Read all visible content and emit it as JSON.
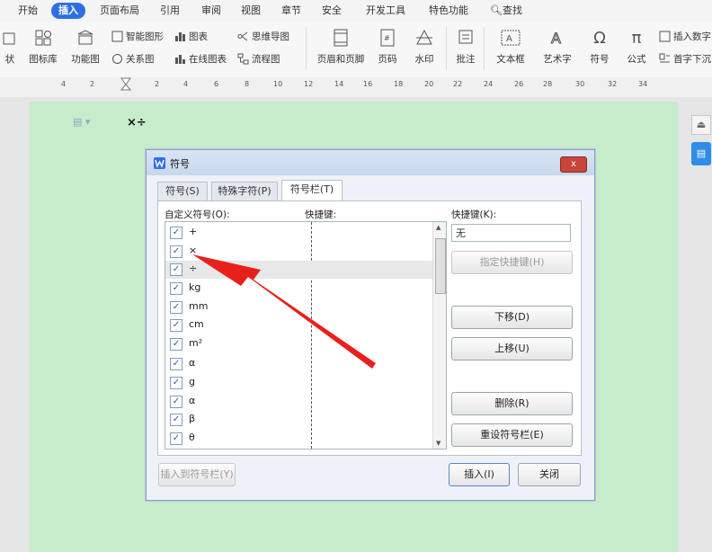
{
  "menu": {
    "tabs": [
      "开始",
      "插入",
      "页面布局",
      "引用",
      "审阅",
      "视图",
      "章节",
      "安全",
      "开发工具",
      "特色功能"
    ],
    "active_tab": "插入",
    "search_label": "查找"
  },
  "ribbon": {
    "shape_partial": "状",
    "icon_library": "图标库",
    "function_chart": "功能图",
    "smart_shape": "智能图形",
    "chart": "图表",
    "mind_map": "思维导图",
    "relation_chart": "关系图",
    "online_chart": "在线图表",
    "flow_chart": "流程图",
    "header_footer": "页眉和页脚",
    "page_number": "页码",
    "watermark": "水印",
    "comment": "批注",
    "text_box": "文本框",
    "art_text": "艺术字",
    "symbol": "符号",
    "formula": "公式",
    "insert_number": "插入数字",
    "drop_cap": "首字下沉"
  },
  "ruler": {
    "ticks": [
      "4",
      "2",
      "2",
      "4",
      "6",
      "8",
      "10",
      "12",
      "14",
      "16",
      "18",
      "20",
      "22",
      "24",
      "26",
      "28",
      "30",
      "32",
      "34"
    ]
  },
  "document": {
    "text": "×÷"
  },
  "dialog": {
    "title": "符号",
    "close_label": "x",
    "tabs": [
      "符号(S)",
      "特殊字符(P)",
      "符号栏(T)"
    ],
    "active_tab": "符号栏(T)",
    "custom_symbols_label": "自定义符号(O):",
    "shortcut_col_label": "快捷键:",
    "shortcut_key_label": "快捷键(K):",
    "shortcut_value": "无",
    "symbols": [
      "+",
      "×",
      "÷",
      "kg",
      "mm",
      "cm",
      "m²",
      "α",
      "g",
      "α",
      "β",
      "θ"
    ],
    "selected_index": 2,
    "assign_shortcut": "指定快捷键(H)",
    "move_down": "下移(D)",
    "move_up": "上移(U)",
    "delete": "删除(R)",
    "reset": "重设符号栏(E)",
    "insert_to_bar": "插入到符号栏(Y)",
    "insert": "插入(I)",
    "close": "关闭"
  },
  "colors": {
    "accent": "#2f6fe6",
    "page_bg": "#c6eccb",
    "arrow": "#e8201c"
  }
}
